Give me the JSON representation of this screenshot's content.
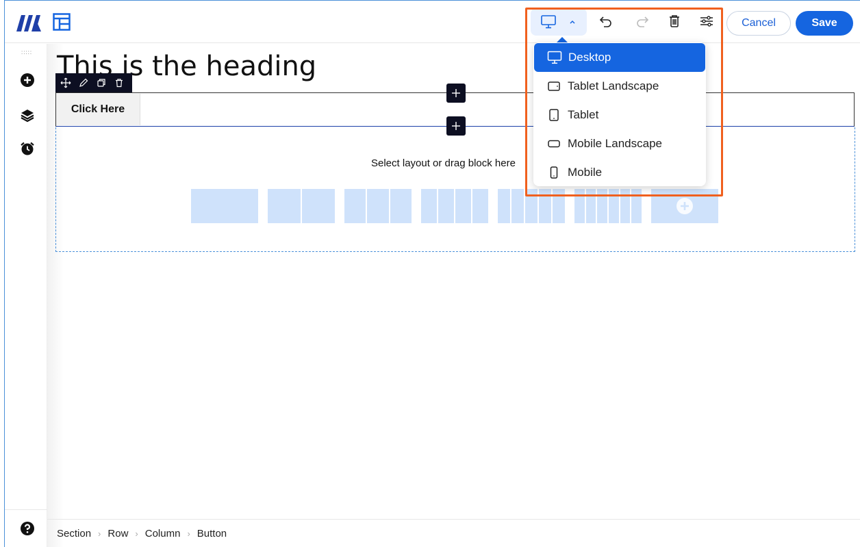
{
  "toolbar": {
    "cancel_label": "Cancel",
    "save_label": "Save"
  },
  "device_dropdown": {
    "items": [
      {
        "label": "Desktop",
        "icon": "desktop-icon",
        "active": true
      },
      {
        "label": "Tablet Landscape",
        "icon": "tablet-landscape-icon",
        "active": false
      },
      {
        "label": "Tablet",
        "icon": "tablet-icon",
        "active": false
      },
      {
        "label": "Mobile Landscape",
        "icon": "mobile-landscape-icon",
        "active": false
      },
      {
        "label": "Mobile",
        "icon": "mobile-icon",
        "active": false
      }
    ]
  },
  "canvas": {
    "heading": "This is the heading",
    "button_label": "Click Here",
    "layout_hint": "Select layout or drag block here"
  },
  "breadcrumb": [
    "Section",
    "Row",
    "Column",
    "Button"
  ],
  "colors": {
    "accent": "#1565e0",
    "highlight": "#f0601e",
    "block_toolbar": "#0d0f22",
    "layout_fill": "#cfe2fb"
  }
}
